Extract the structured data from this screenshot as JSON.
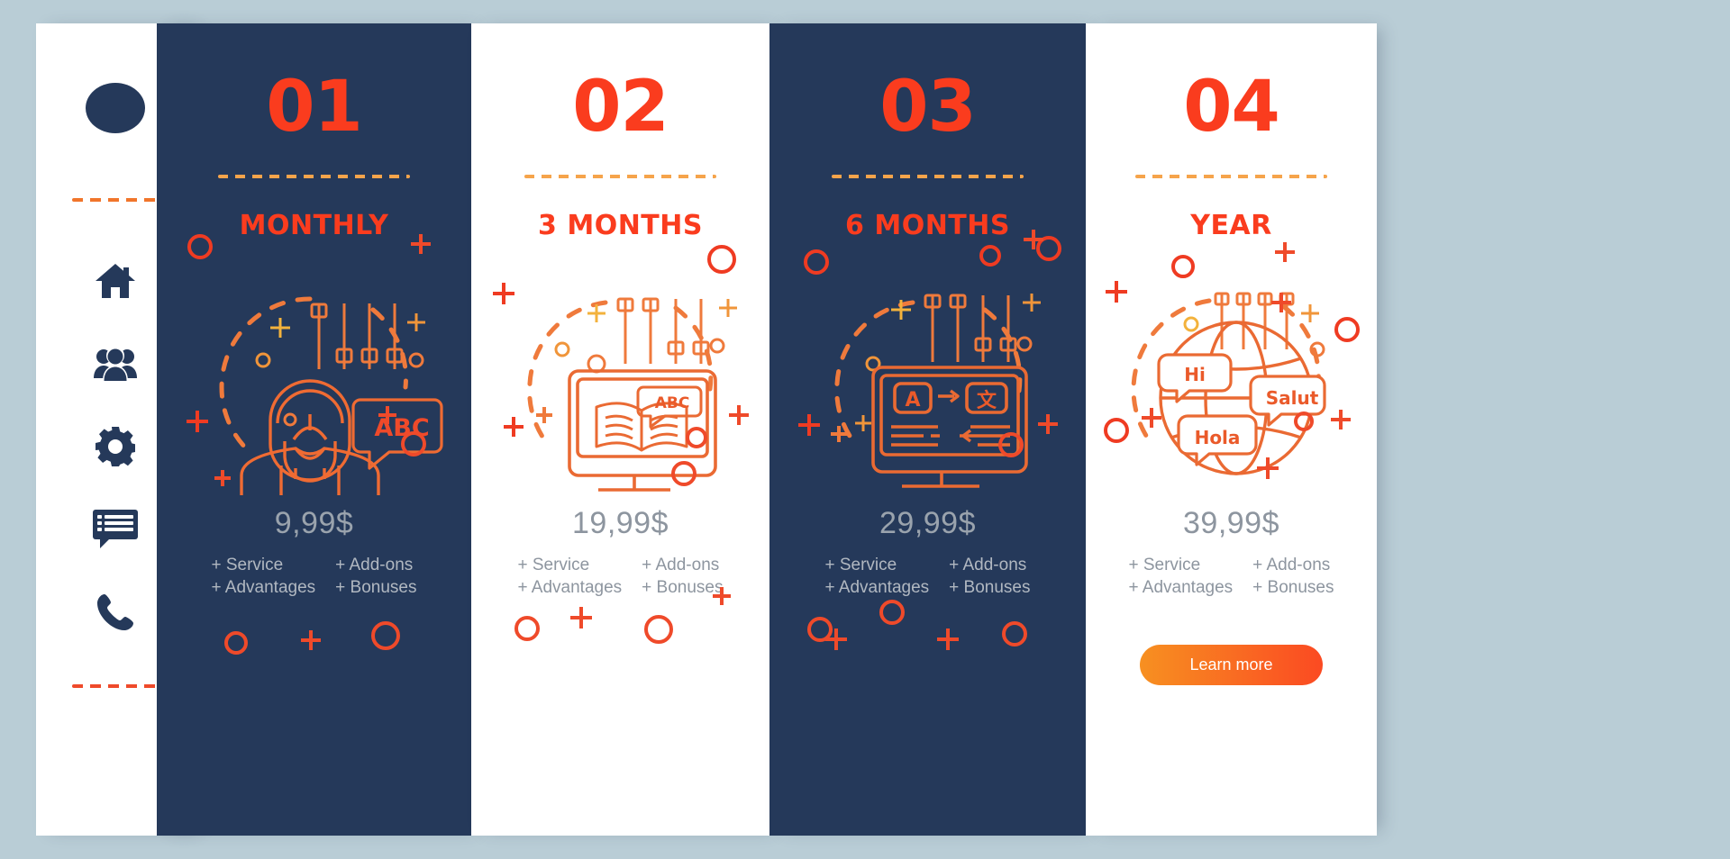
{
  "theme": {
    "page_bg": "#b9cdd6",
    "dark_card": "#25395a",
    "light_card": "#ffffff",
    "accent_red": "#fa3c1e",
    "accent_orange": "#f79021",
    "price_gray": "#9aa3ad"
  },
  "sidebar": {
    "logo": "logo-dot",
    "items": [
      {
        "icon": "home-icon",
        "name": "home"
      },
      {
        "icon": "users-icon",
        "name": "users"
      },
      {
        "icon": "gear-icon",
        "name": "settings"
      },
      {
        "icon": "chat-list-icon",
        "name": "messages"
      },
      {
        "icon": "phone-icon",
        "name": "call"
      }
    ]
  },
  "cards": [
    {
      "number": "01",
      "title": "MONTHLY",
      "price": "9,99$",
      "features": [
        "+ Service",
        "+ Add-ons",
        "+ Advantages",
        "+ Bonuses"
      ],
      "illustration": "tutor-abc-icon",
      "theme": "dark",
      "cta": null
    },
    {
      "number": "02",
      "title": "3 MONTHS",
      "price": "19,99$",
      "features": [
        "+ Service",
        "+ Add-ons",
        "+ Advantages",
        "+ Bonuses"
      ],
      "illustration": "monitor-book-abc-icon",
      "theme": "light",
      "cta": null
    },
    {
      "number": "03",
      "title": "6 MONTHS",
      "price": "29,99$",
      "features": [
        "+ Service",
        "+ Add-ons",
        "+ Advantages",
        "+ Bonuses"
      ],
      "illustration": "translation-screen-icon",
      "theme": "dark",
      "cta": null
    },
    {
      "number": "04",
      "title": "YEAR",
      "price": "39,99$",
      "features": [
        "+ Service",
        "+ Add-ons",
        "+ Advantages",
        "+ Bonuses"
      ],
      "illustration": "globe-greetings-icon",
      "theme": "light",
      "cta": "Learn more"
    }
  ],
  "illustration_text": {
    "card1_bubble": "ABC",
    "card2_book": "ABC",
    "card3_source": "A",
    "card3_target": "文",
    "card4_bubbles": [
      "Hi",
      "Salut",
      "Hola"
    ]
  }
}
